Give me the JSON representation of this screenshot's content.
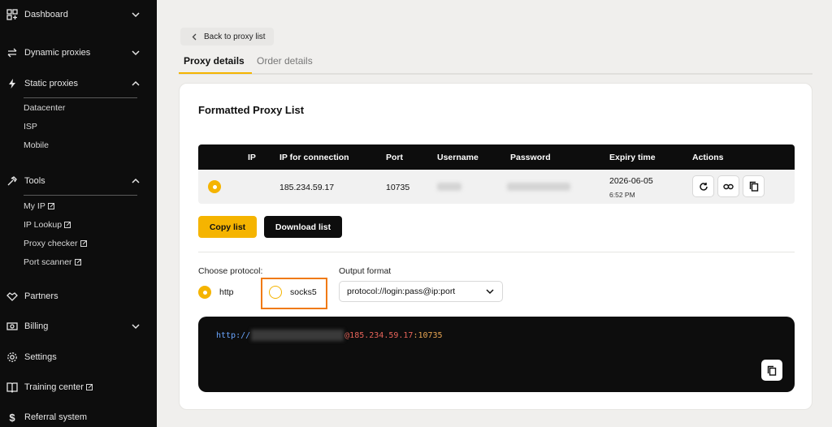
{
  "sidebar": {
    "items": [
      {
        "label": "Dashboard"
      },
      {
        "label": "Dynamic proxies"
      },
      {
        "label": "Static proxies"
      },
      {
        "label": "Tools"
      },
      {
        "label": "Partners"
      },
      {
        "label": "Billing"
      },
      {
        "label": "Settings"
      },
      {
        "label": "Training center"
      },
      {
        "label": "Referral system"
      }
    ],
    "static_sub": [
      "Datacenter",
      "ISP",
      "Mobile"
    ],
    "tools_sub": [
      "My IP",
      "IP Lookup",
      "Proxy checker",
      "Port scanner"
    ]
  },
  "back_label": "Back to proxy list",
  "tabs": [
    {
      "label": "Proxy details",
      "active": true
    },
    {
      "label": "Order details",
      "active": false
    }
  ],
  "card": {
    "title": "Formatted Proxy List",
    "table": {
      "headers": [
        "IP",
        "IP for connection",
        "Port",
        "Username",
        "Password",
        "Expiry time",
        "Actions"
      ],
      "row": {
        "ip_connection": "185.234.59.17",
        "port": "10735",
        "expiry_date": "2026-06-05",
        "expiry_time": "6:52 PM"
      }
    },
    "copy_label": "Copy list",
    "download_label": "Download list",
    "protocol_label": "Choose protocol:",
    "protocols": [
      {
        "label": "http",
        "selected": true
      },
      {
        "label": "socks5",
        "selected": false
      }
    ],
    "output_label": "Output format",
    "output_value": "protocol://login:pass@ip:port",
    "code": {
      "scheme": "http://",
      "at_host": "@185.234.59.17",
      "port": ":10735"
    }
  },
  "colors": {
    "accent": "#f5b400",
    "highlight": "#f07a12",
    "sidebar_bg": "#0d0d0d"
  }
}
